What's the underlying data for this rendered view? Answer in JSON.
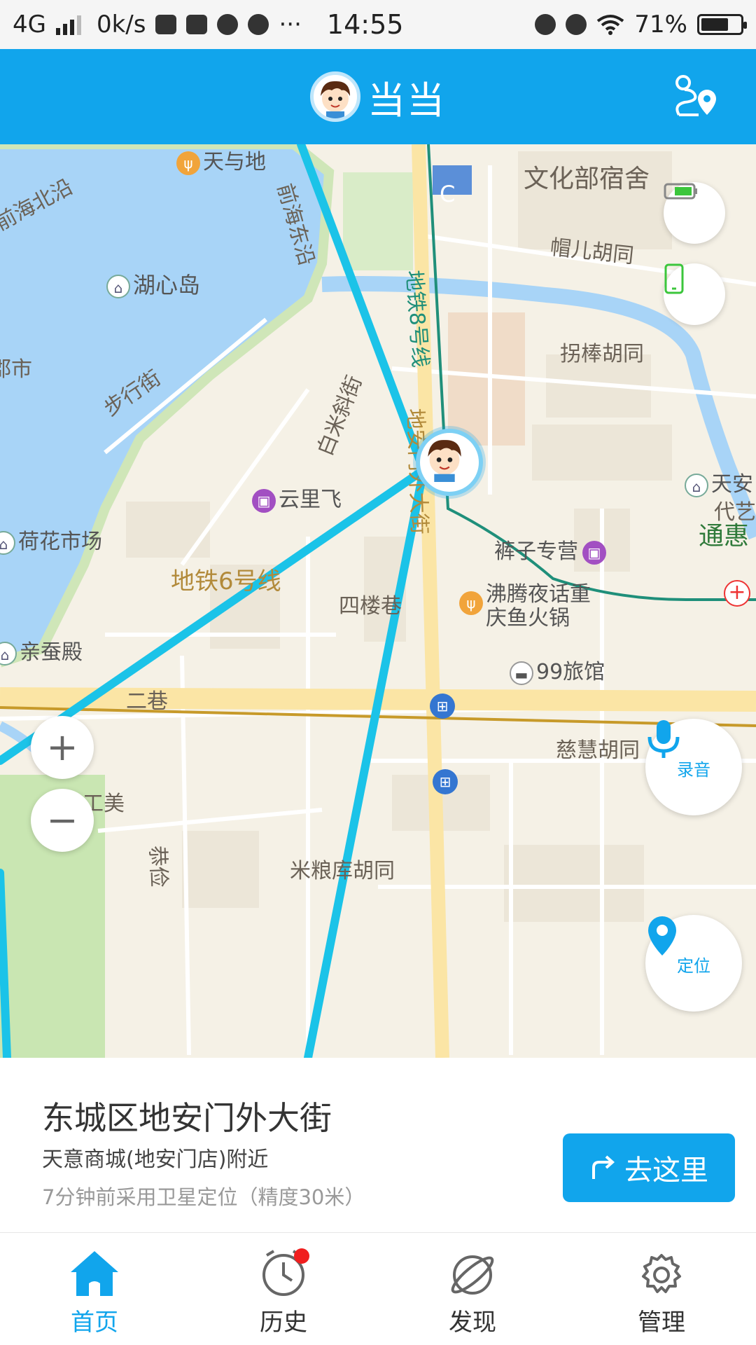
{
  "status_bar": {
    "network": "4G",
    "speed": "0k/s",
    "time": "14:55",
    "battery": "71%",
    "battery_fraction": 0.71
  },
  "header": {
    "title": "当当"
  },
  "map": {
    "labels": {
      "tianyudi": "天与地",
      "qianhai_beiyan": "前海北沿",
      "qianhai_dongyan": "前海东沿",
      "wenhuabu": "文化部宿舍",
      "huxindao": "湖心岛",
      "maoer": "帽儿胡同",
      "subway8": "地铁8号线",
      "guaibang": "拐棒胡同",
      "shi": "郡市",
      "buxingjie": "步行街",
      "baimi": "白米斜街",
      "dian": "地安门外大街",
      "tianan": "天安",
      "daiyi": "代艺",
      "yunlifei": "云里飞",
      "hehua": "荷花市场",
      "kuzi": "裤子专营",
      "tonghui": "通惠",
      "subway6": "地铁6号线",
      "silou": "四楼巷",
      "feiteng1": "沸腾夜话重",
      "feiteng2": "庆鱼火锅",
      "qincan": "亲蚕殿",
      "hotel99": "99旅馆",
      "erxiang": "二巷",
      "cihui": "慈慧胡同",
      "gongmei": "工美",
      "gongjian": "恭俭",
      "mitang": "米粮库胡同",
      "c_marker": "C"
    }
  },
  "controls": {
    "record_label": "录音",
    "locate_label": "定位"
  },
  "location": {
    "address": "东城区地安门外大街",
    "nearby": "天意商城(地安门店)附近",
    "meta": "7分钟前采用卫星定位（精度30米）",
    "go_button": "去这里"
  },
  "tabs": [
    {
      "label": "首页",
      "icon": "home-icon",
      "active": true
    },
    {
      "label": "历史",
      "icon": "clock-icon",
      "active": false,
      "badge": true
    },
    {
      "label": "发现",
      "icon": "planet-icon",
      "active": false
    },
    {
      "label": "管理",
      "icon": "gear-icon",
      "active": false
    }
  ],
  "colors": {
    "primary": "#11a5ec",
    "badge": "#f01e1e",
    "route": "#1bc3e8",
    "water": "#a8d4f7"
  }
}
